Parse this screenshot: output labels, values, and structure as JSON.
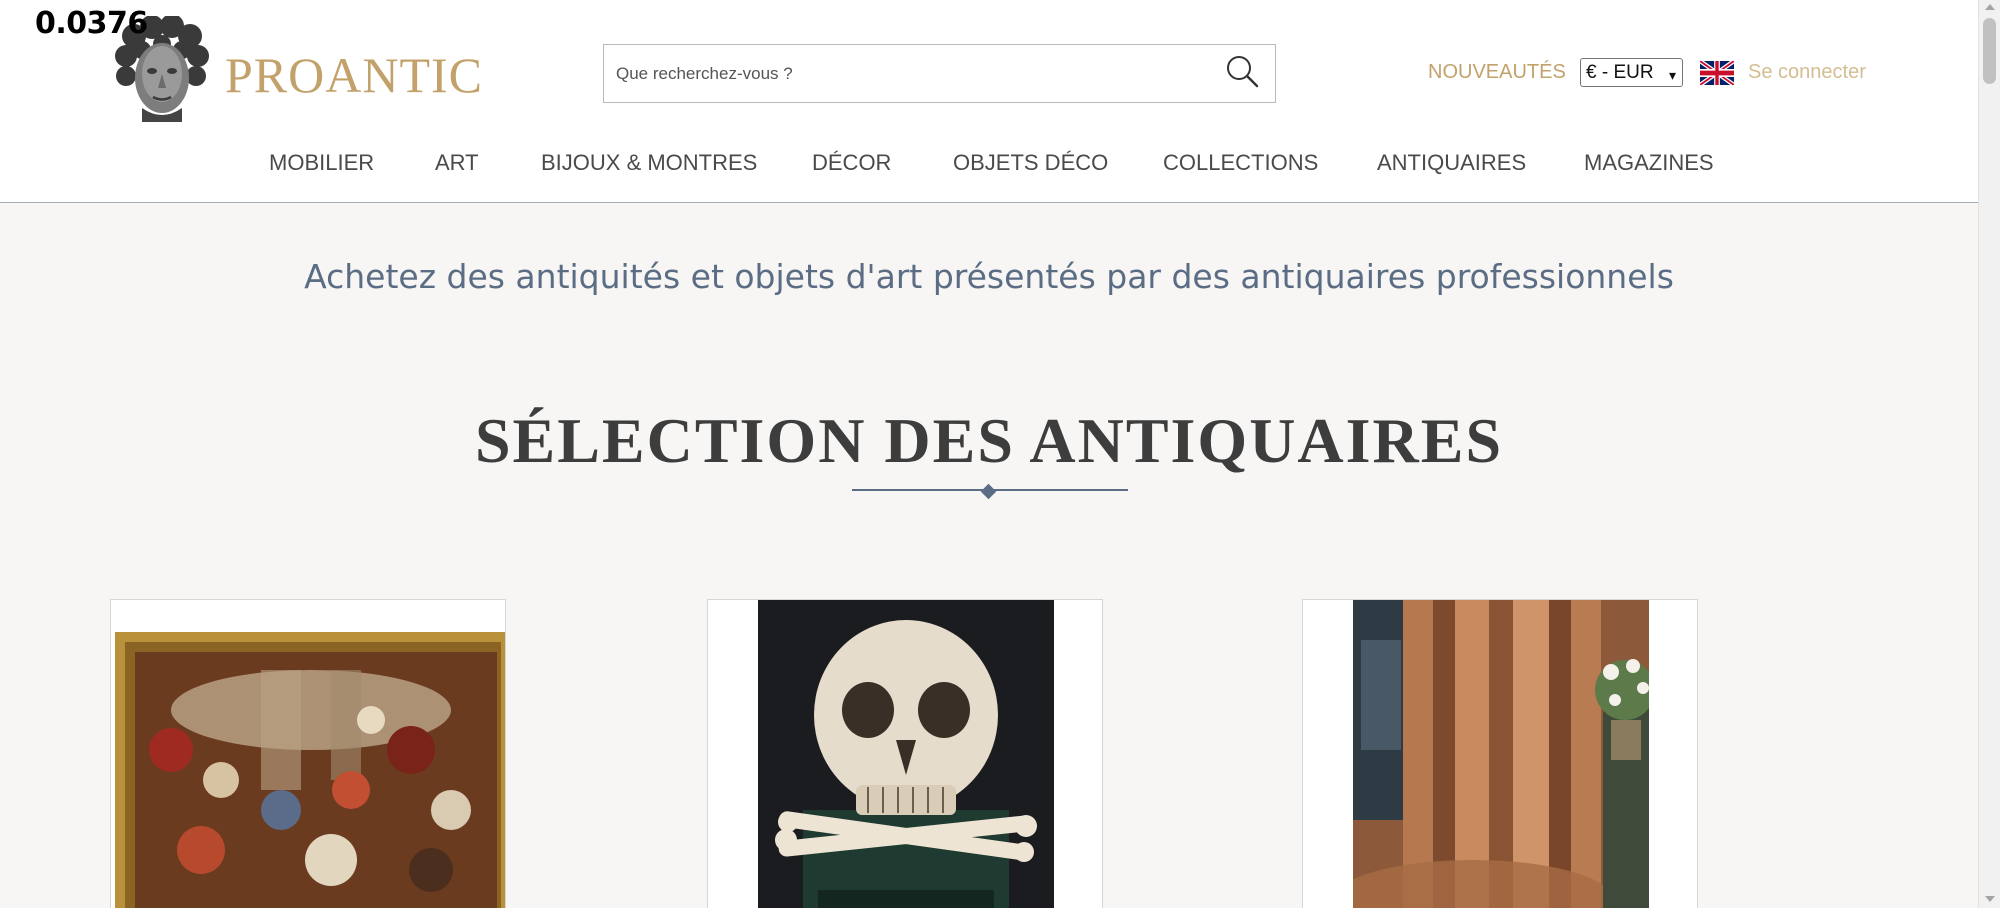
{
  "overlay": {
    "value": "0.0376"
  },
  "header": {
    "logo_text": "PROANTIC",
    "search_placeholder": "Que recherchez-vous ?",
    "nouveautes": "NOUVEAUTÉS",
    "currency": "€ - EUR",
    "login": "Se connecter"
  },
  "nav": {
    "items": [
      "MOBILIER",
      "ART",
      "BIJOUX & MONTRES",
      "DÉCOR",
      "OBJETS DÉCO",
      "COLLECTIONS",
      "ANTIQUAIRES",
      "MAGAZINES"
    ]
  },
  "main": {
    "tagline": "Achetez des antiquités et objets d'art présentés par des antiquaires professionnels",
    "section_title": "SÉLECTION DES ANTIQUAIRES"
  },
  "colors": {
    "brand_gold": "#c2a26a",
    "accent_blue": "#5a6d84",
    "page_bg": "#f7f6f4"
  },
  "icons": [
    "logo-head-icon",
    "search-icon",
    "uk-flag-icon"
  ]
}
